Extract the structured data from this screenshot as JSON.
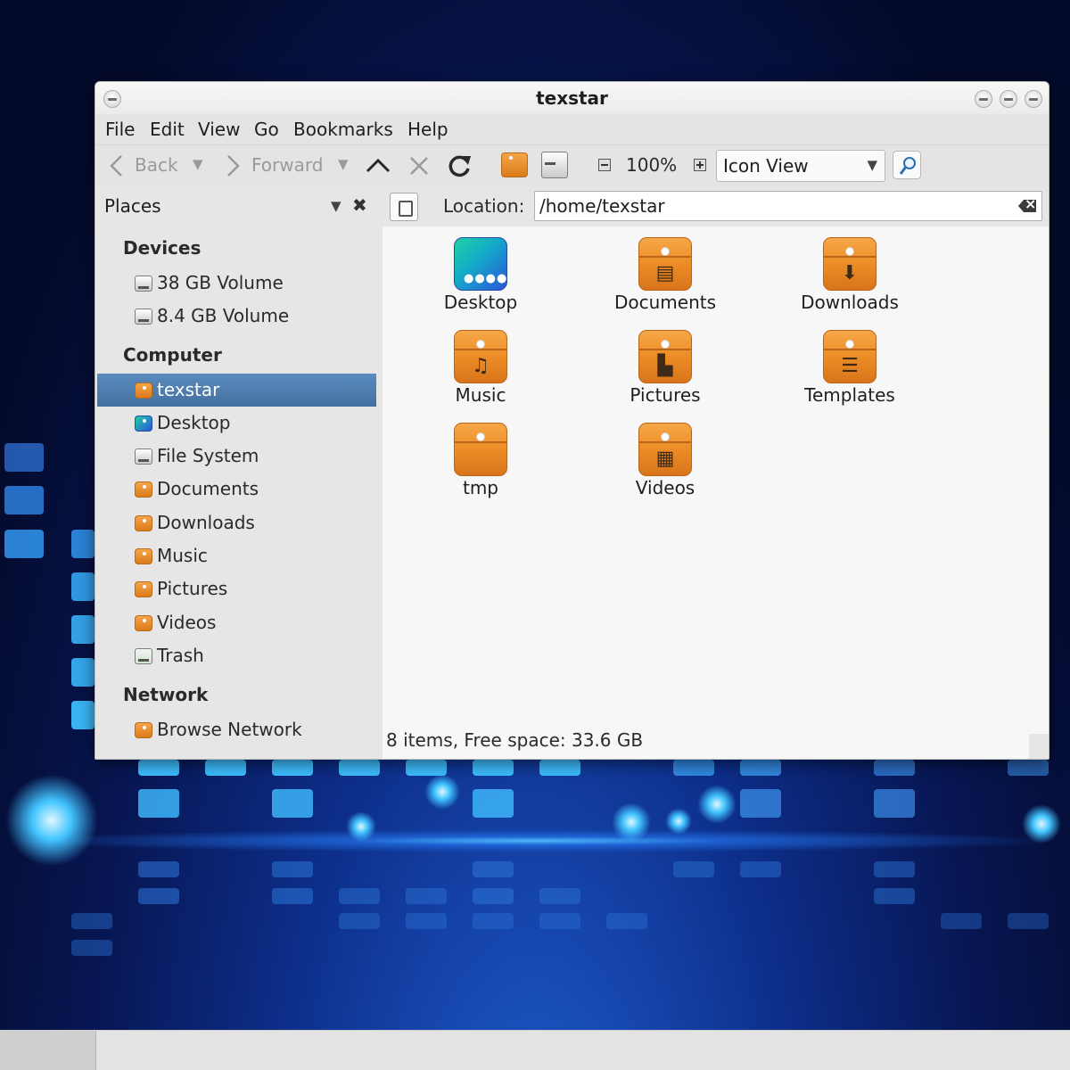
{
  "window": {
    "title": "texstar"
  },
  "menu": [
    "File",
    "Edit",
    "View",
    "Go",
    "Bookmarks",
    "Help"
  ],
  "toolbar": {
    "back_label": "Back",
    "forward_label": "Forward",
    "zoom_level": "100%",
    "view_mode": "Icon View"
  },
  "sidebar": {
    "title": "Places",
    "devices_heading": "Devices",
    "devices": [
      "38 GB Volume",
      "8.4 GB Volume"
    ],
    "computer_heading": "Computer",
    "computer": [
      "texstar",
      "Desktop",
      "File System",
      "Documents",
      "Downloads",
      "Music",
      "Pictures",
      "Videos",
      "Trash"
    ],
    "network_heading": "Network",
    "network": [
      "Browse Network"
    ]
  },
  "location": {
    "label": "Location:",
    "path": "/home/texstar"
  },
  "files": [
    "Desktop",
    "Documents",
    "Downloads",
    "Music",
    "Pictures",
    "Templates",
    "tmp",
    "Videos"
  ],
  "status": "8 items, Free space: 33.6 GB",
  "colors": {
    "selection": "#4f7fb2",
    "folder": "#ee8f28"
  }
}
